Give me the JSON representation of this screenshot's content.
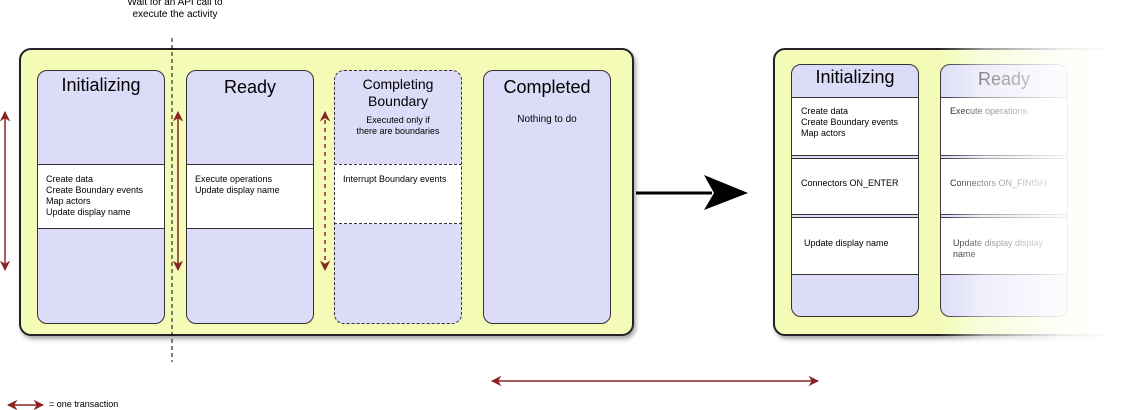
{
  "top_note": [
    "Wait for an API call to",
    "execute the activity"
  ],
  "left_panel": {
    "initializing": {
      "title": "Initializing",
      "items": [
        "Create data",
        "Create Boundary events",
        "Map actors",
        "Update display name"
      ]
    },
    "ready": {
      "title": "Ready",
      "items": [
        "Execute operations",
        "Update display name"
      ]
    },
    "completing_boundary": {
      "title_lines": [
        "Completing",
        "Boundary"
      ],
      "note": [
        "Executed only if",
        "there are boundaries"
      ],
      "items": [
        "Interrupt Boundary events"
      ]
    },
    "completed": {
      "title": "Completed",
      "note": "Nothing to do"
    }
  },
  "right_panel": {
    "initializing": {
      "title": "Initializing",
      "box1": [
        "Create data",
        "Create Boundary events",
        "Map actors"
      ],
      "box2": "Connectors ON_ENTER",
      "box3": "Update display name"
    },
    "ready": {
      "title": "Ready",
      "box1": "Execute operations",
      "box2": "Connectors ON_FINISH",
      "box3": "Update display display name"
    }
  },
  "legend": {
    "text": "= one transaction"
  },
  "colors": {
    "panel_bg": "#f3fbb6",
    "column_bg": "#dcdcf8",
    "transaction_arrow": "#8b2323",
    "main_arrow": "#000000"
  }
}
